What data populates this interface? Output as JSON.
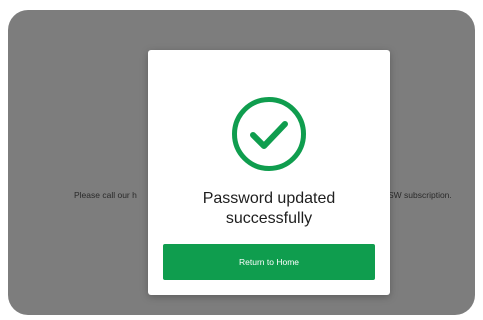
{
  "background": {
    "text_left": "Please call our h",
    "text_right": "SW subscription."
  },
  "modal": {
    "icon": "check-circle-icon",
    "title_line1": "Password updated",
    "title_line2": "successfully",
    "button_label": "Return to Home"
  },
  "colors": {
    "accent": "#0f9d4e",
    "overlay": "#7d7d7d"
  }
}
